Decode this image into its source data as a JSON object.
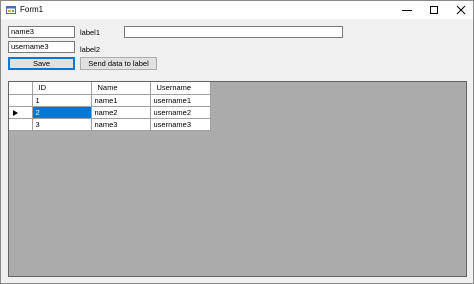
{
  "window": {
    "title": "Form1"
  },
  "form": {
    "textbox1_value": "name3",
    "textbox2_value": "username3",
    "textbox3_value": "",
    "label1": "label1",
    "label2": "label2",
    "save_label": "Save",
    "send_label": "Send data to label"
  },
  "grid": {
    "columns": [
      "ID",
      "Name",
      "Username"
    ],
    "rows": [
      [
        "1",
        "name1",
        "username1"
      ],
      [
        "2",
        "name2",
        "username2"
      ],
      [
        "3",
        "name3",
        "username3"
      ]
    ],
    "current_row": 1,
    "selection_color": "#0078d7"
  },
  "colors": {
    "form_background": "#f0f0f0",
    "grid_background": "#ababab",
    "focus_border": "#0078d7"
  }
}
